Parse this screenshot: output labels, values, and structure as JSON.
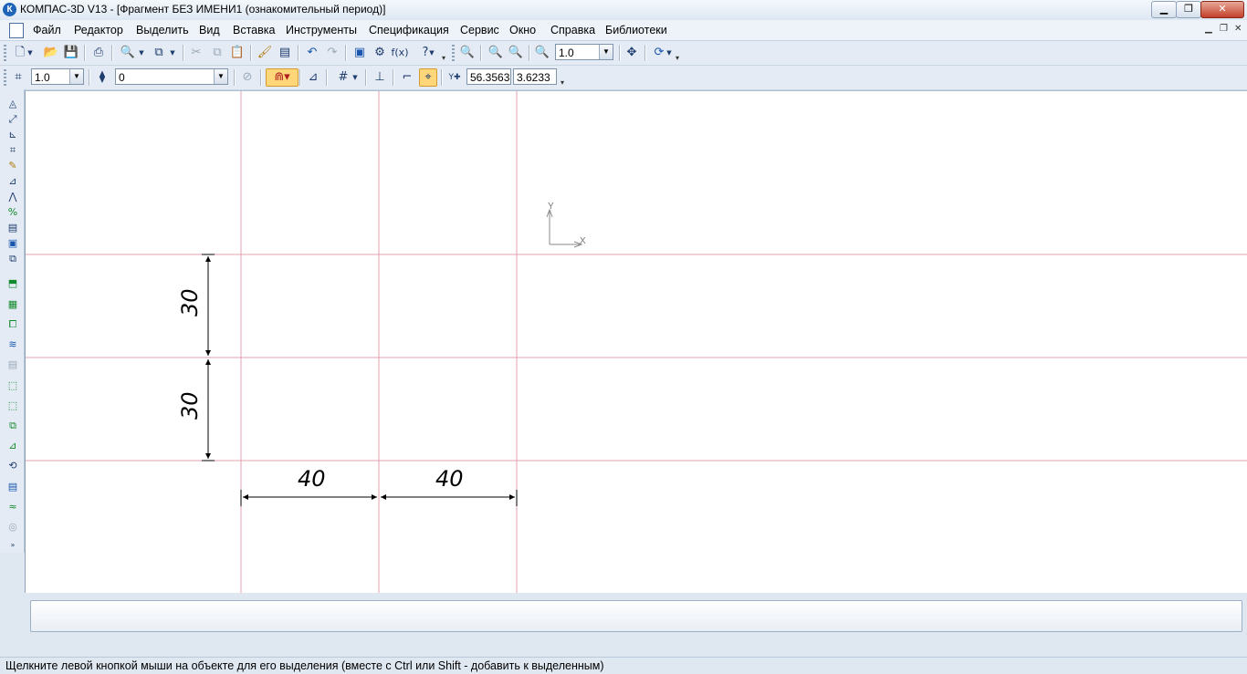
{
  "window": {
    "title": "КОМПАС-3D V13 - [Фрагмент БЕЗ ИМЕНИ1 (ознакомительный период)]",
    "app_icon": "К",
    "controls": [
      "minimize-icon",
      "maximize-icon",
      "close-icon"
    ]
  },
  "menu": {
    "items": [
      {
        "label": "Файл"
      },
      {
        "label": "Редактор"
      },
      {
        "label": "Выделить"
      },
      {
        "label": "Вид"
      },
      {
        "label": "Вставка"
      },
      {
        "label": "Инструменты"
      },
      {
        "label": "Спецификация"
      },
      {
        "label": "Сервис"
      },
      {
        "label": "Окно"
      },
      {
        "label": "Справка"
      },
      {
        "label": "Библиотеки"
      }
    ]
  },
  "standard_toolbar": {
    "zoom_value": "1.0",
    "icons": [
      "new-document-icon",
      "open-icon",
      "save-icon",
      "print-icon",
      "preview-icon",
      "properties-icon",
      "cut-icon",
      "copy-icon",
      "paste-icon",
      "format-brush-icon",
      "variables-icon",
      "undo-icon",
      "redo-icon",
      "manager-icon",
      "library-icon",
      "fx-icon",
      "help-icon",
      "zoom-window-icon",
      "zoom-in-icon",
      "zoom-out-icon",
      "zoom-scale-icon",
      "pan-icon",
      "refresh-icon"
    ]
  },
  "current_state_toolbar": {
    "step_value": "1.0",
    "layer_value": "0",
    "coord_x": "56.3563",
    "coord_y": "3.6233",
    "icons": [
      "step-cursor-icon",
      "layer-icon",
      "snap-icon",
      "magnet-icon",
      "ortho-icon",
      "grid-icon",
      "local-cs-icon",
      "round-icon",
      "cursor-coords-icon"
    ]
  },
  "left_toolbar": {
    "icons": [
      "geometry-icon",
      "dimensions-icon",
      "notation-icon",
      "edit-icon",
      "params-icon",
      "measure-icon",
      "select-icon",
      "spec-icon",
      "report-icon",
      "insert-icon",
      "assoc-views-icon",
      "macro-icon",
      "view-icon",
      "layer-icon",
      "attrib-icon",
      "frame-icon",
      "rect-frame-icon",
      "crop-icon",
      "scale-icon",
      "rotate-icon",
      "mirror-icon",
      "wave-icon",
      "round-dot-icon",
      "more-icon"
    ]
  },
  "drawing": {
    "dimensions": [
      {
        "label": "30",
        "orientation": "vertical"
      },
      {
        "label": "30",
        "orientation": "vertical"
      },
      {
        "label": "40",
        "orientation": "horizontal"
      },
      {
        "label": "40",
        "orientation": "horizontal"
      }
    ],
    "axis_x_label": "X",
    "axis_y_label": "Y",
    "guide_line_color": "#e3a0b0"
  },
  "status": {
    "text": "Щелкните левой кнопкой мыши на объекте для его выделения (вместе с Ctrl или Shift - добавить к выделенным)"
  }
}
